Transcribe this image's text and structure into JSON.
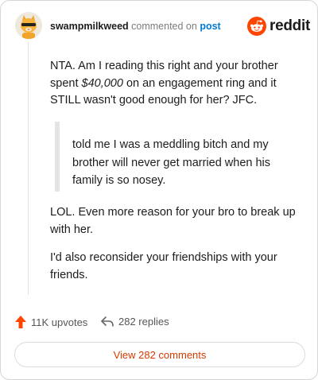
{
  "comment": {
    "username": "swampmilkweed",
    "action_text": "commented on",
    "target_link": "post",
    "brand_name": "reddit",
    "paragraph1": {
      "before": "NTA. Am I reading this right and your brother spent ",
      "emphasis": "$40,000",
      "after": " on an engagement ring and it STILL wasn't good enough for her? JFC."
    },
    "quote": "told me I was a meddling bitch and my brother will never get married when his family is so nosey.",
    "paragraph2": "LOL. Even more reason for your bro to break up with her.",
    "paragraph3": "I'd also reconsider your friendships with your friends."
  },
  "footer": {
    "upvotes": "11K upvotes",
    "replies": "282 replies",
    "view_button": "View 282 comments"
  },
  "icons": {
    "avatar": "cat-avatar-icon",
    "brand": "reddit-logo-icon",
    "upvote": "upvote-arrow-icon",
    "reply": "reply-arrow-icon"
  },
  "colors": {
    "brand_orange": "#ff4500",
    "link_blue": "#0079d3",
    "button_text": "#d93a00"
  }
}
